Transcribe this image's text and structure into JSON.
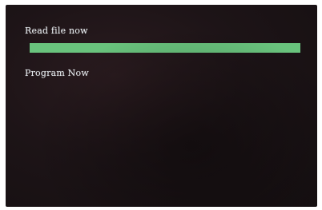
{
  "screen": {
    "line_1": "Read file now",
    "line_2": "Program Now"
  },
  "progress": {
    "value": 1.0,
    "color": "#69c37d"
  }
}
